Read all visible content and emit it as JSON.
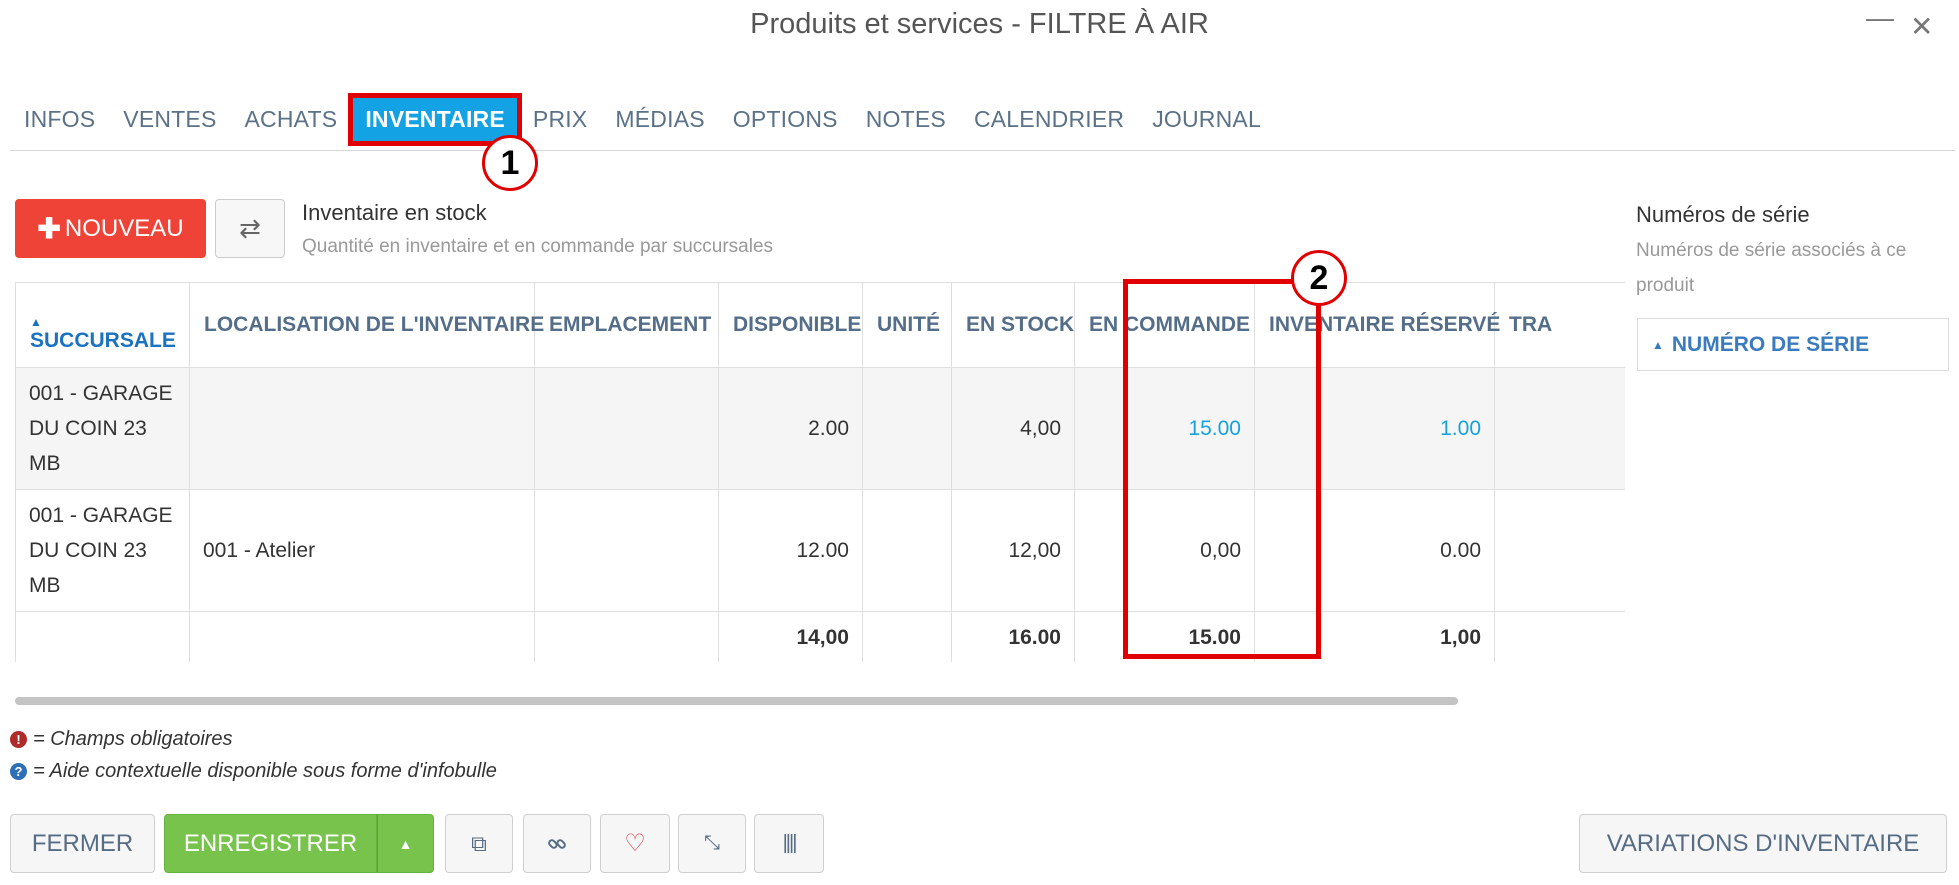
{
  "window": {
    "title": "Produits et services - FILTRE À AIR",
    "minimize": "—",
    "close": "✕"
  },
  "tabs": [
    {
      "label": "INFOS"
    },
    {
      "label": "VENTES"
    },
    {
      "label": "ACHATS"
    },
    {
      "label": "INVENTAIRE",
      "active": true
    },
    {
      "label": "PRIX"
    },
    {
      "label": "MÉDIAS"
    },
    {
      "label": "OPTIONS"
    },
    {
      "label": "NOTES"
    },
    {
      "label": "CALENDRIER"
    },
    {
      "label": "JOURNAL"
    }
  ],
  "toolbar": {
    "new_label": "NOUVEAU",
    "new_icon": "plus-icon",
    "swap_icon": "swap-arrows-icon"
  },
  "section": {
    "title": "Inventaire en stock",
    "subtitle": "Quantité en inventaire et en commande par succursales"
  },
  "serial": {
    "title": "Numéros de série",
    "subtitle": "Numéros de série associés à ce produit",
    "column": "NUMÉRO DE SÉRIE",
    "sort_icon": "sort-up-icon"
  },
  "table": {
    "headers": [
      "SUCCURSALE",
      "LOCALISATION DE L'INVENTAIRE",
      "EMPLACEMENT",
      "DISPONIBLE",
      "UNITÉ",
      "EN STOCK",
      "EN COMMANDE",
      "INVENTAIRE RÉSERVÉ",
      "TRA"
    ],
    "rows": [
      [
        "001 - GARAGE DU COIN 23 MB",
        "",
        "",
        "2.00",
        "",
        "4,00",
        "15.00",
        "1.00",
        ""
      ],
      [
        "001 - GARAGE DU COIN 23 MB",
        "001 - Atelier",
        "",
        "12.00",
        "",
        "12,00",
        "0,00",
        "0.00",
        ""
      ]
    ],
    "totals": [
      "",
      "",
      "",
      "14,00",
      "",
      "16.00",
      "15.00",
      "1,00",
      ""
    ]
  },
  "legend": {
    "required_icon": "!",
    "required_text": "= Champs obligatoires",
    "help_icon": "?",
    "help_text": "= Aide contextuelle disponible sous forme d'infobulle"
  },
  "footer": {
    "close_label": "FERMER",
    "save_label": "ENREGISTRER",
    "save_dropdown": "▲",
    "icons": [
      "copy-icon",
      "link-icon",
      "heart-icon",
      "collapse-icon",
      "barcode-icon"
    ],
    "icon_glyphs": [
      "⧉",
      "🔗",
      "♡",
      "⤡",
      "||||"
    ],
    "variations_label": "VARIATIONS D'INVENTAIRE"
  },
  "annotations": {
    "badge1": "1",
    "badge2": "2"
  },
  "colors": {
    "accent": "#13a3e4",
    "danger": "#f04338",
    "success": "#77c34b",
    "highlight": "#e00000",
    "link": "#17a2dd"
  }
}
